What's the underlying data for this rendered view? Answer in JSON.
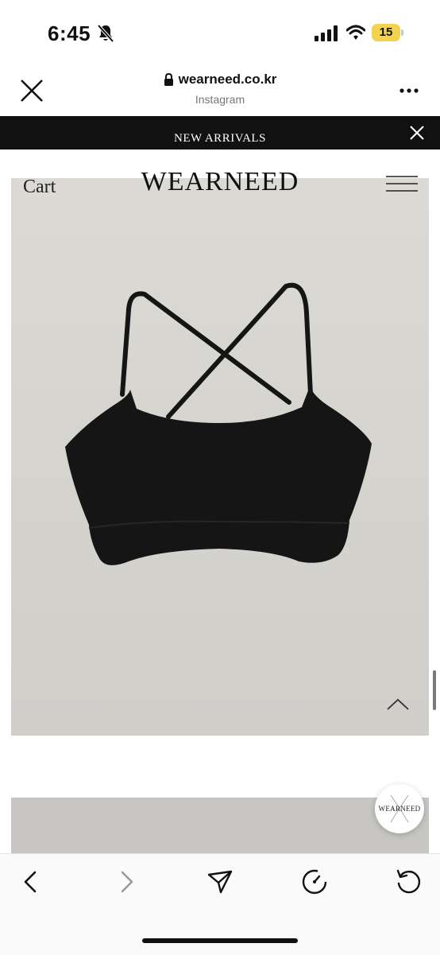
{
  "status_bar": {
    "time": "6:45",
    "battery_level": "15"
  },
  "browser": {
    "url": "wearneed.co.kr",
    "source": "Instagram"
  },
  "banner": {
    "text": "NEW ARRIVALS"
  },
  "site": {
    "cart_label": "Cart",
    "logo": "WEARNEED"
  },
  "floating_logo": {
    "text": "WEARNEED"
  },
  "colors": {
    "banner_bg": "#111111",
    "battery": "#f1d34f",
    "product_bg": "#d7d5cf",
    "garment": "#151515"
  }
}
